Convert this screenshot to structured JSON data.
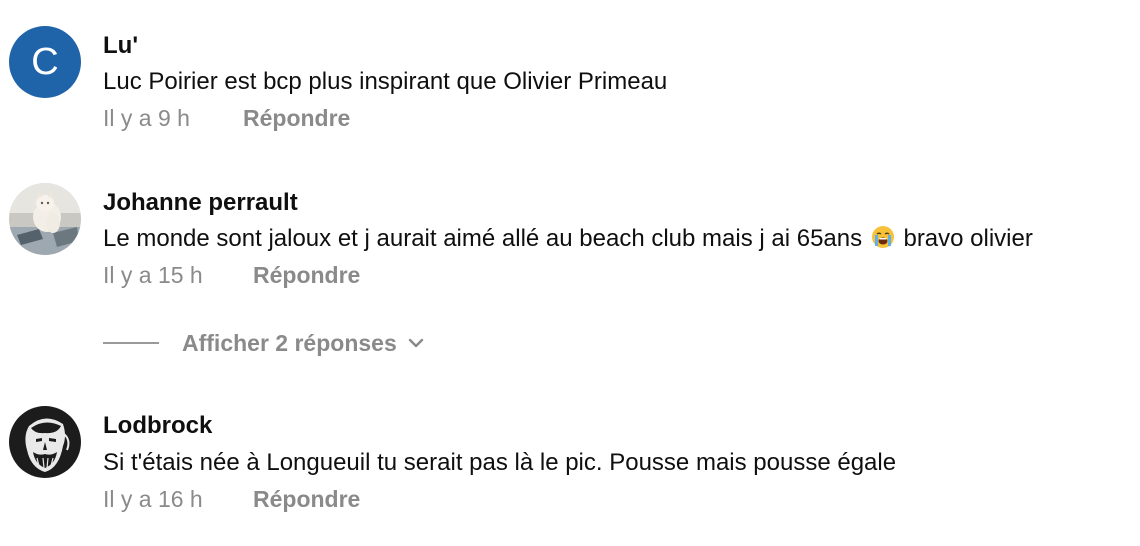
{
  "comments": [
    {
      "avatar_letter": "C",
      "avatar_color": "#1f63a8",
      "author": "Lu'",
      "text": "Luc Poirier est bcp plus inspirant que Olivier Primeau",
      "time": "Il y a 9 h",
      "reply_label": "Répondre"
    },
    {
      "avatar_icon": "cat-photo-avatar",
      "author": "Johanne perrault",
      "text_before_emoji": "Le monde sont jaloux et j aurait aimé allé au beach club mais j ai 65ans",
      "emoji_icon": "loudly-crying-face-emoji",
      "text_after_emoji": "bravo olivier",
      "time": "Il y a 15 h",
      "reply_label": "Répondre",
      "show_replies_label": "Afficher 2 réponses"
    },
    {
      "avatar_icon": "bearded-warrior-avatar",
      "author": "Lodbrock",
      "text": "Si t'étais née à Longueuil tu serait pas là le pic. Pousse mais pousse égale",
      "time": "Il y a 16 h",
      "reply_label": "Répondre"
    }
  ]
}
